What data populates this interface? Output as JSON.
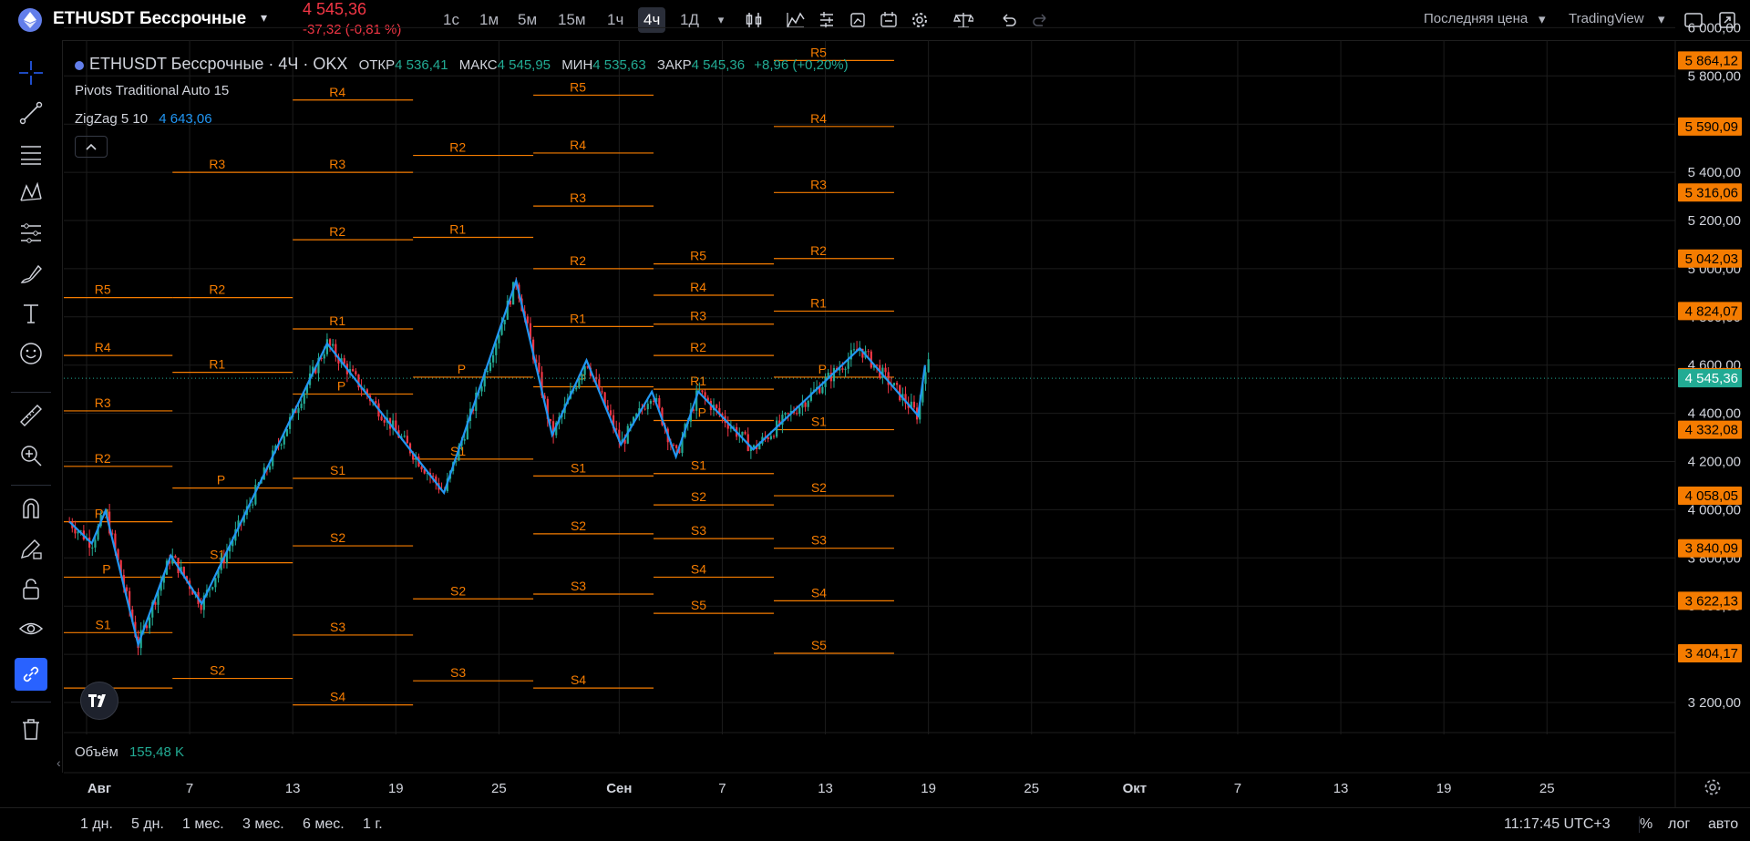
{
  "header": {
    "symbol": "ETHUSDT Бессрочные",
    "price": "4 545,36",
    "change": "-37,32 (-0,81 %)",
    "timeframes": [
      "1с",
      "1м",
      "5м",
      "15м",
      "1ч",
      "4ч",
      "1Д"
    ],
    "active_timeframe": "4ч",
    "price_type": "Последняя цена",
    "broker": "TradingView"
  },
  "legend": {
    "title": "ETHUSDT Бессрочные · 4Ч · OKX",
    "open_label": "ОТКР",
    "open": "4 536,41",
    "high_label": "МАКС",
    "high": "4 545,95",
    "low_label": "МИН",
    "low": "4 535,63",
    "close_label": "ЗАКР",
    "close": "4 545,36",
    "delta": "+8,96 (+0,20%)",
    "pivots": "Pivots Traditional Auto 15",
    "zigzag_label": "ZigZag 5 10",
    "zigzag_value": "4 643,06",
    "volume_label": "Объём",
    "volume_value": "155,48 K",
    "collapse": "^"
  },
  "axis": {
    "price_ticks": [
      {
        "v": 6000,
        "t": "6 000,00"
      },
      {
        "v": 5800,
        "t": "5 800,00"
      },
      {
        "v": 5600,
        "t": "5 600,00"
      },
      {
        "v": 5400,
        "t": "5 400,00"
      },
      {
        "v": 5200,
        "t": "5 200,00"
      },
      {
        "v": 5000,
        "t": "5 000,00"
      },
      {
        "v": 4800,
        "t": "4 800,00"
      },
      {
        "v": 4600,
        "t": "4 600,00"
      },
      {
        "v": 4400,
        "t": "4 400,00"
      },
      {
        "v": 4200,
        "t": "4 200,00"
      },
      {
        "v": 4000,
        "t": "4 000,00"
      },
      {
        "v": 3800,
        "t": "3 800,00"
      },
      {
        "v": 3600,
        "t": "3 600,00"
      },
      {
        "v": 3400,
        "t": "3 400,00"
      },
      {
        "v": 3200,
        "t": "3 200,00"
      }
    ],
    "price_labels": [
      {
        "v": 5864.12,
        "t": "5 864,12"
      },
      {
        "v": 5590.09,
        "t": "5 590,09"
      },
      {
        "v": 5316.06,
        "t": "5 316,06"
      },
      {
        "v": 5042.03,
        "t": "5 042,03"
      },
      {
        "v": 4824.07,
        "t": "4 824,07"
      },
      {
        "v": 4550.04,
        "t": "4 550,04"
      },
      {
        "v": 4332.08,
        "t": "4 332,08"
      },
      {
        "v": 4058.05,
        "t": "4 058,05"
      },
      {
        "v": 3840.09,
        "t": "3 840,09"
      },
      {
        "v": 3622.13,
        "t": "3 622,13"
      },
      {
        "v": 3404.17,
        "t": "3 404,17"
      }
    ],
    "current_label": {
      "v": 4545.36,
      "t": "4 545,36"
    },
    "time_labels": [
      {
        "d": 0,
        "t": "Авг"
      },
      {
        "d": 6,
        "t": "7"
      },
      {
        "d": 12,
        "t": "13"
      },
      {
        "d": 18,
        "t": "19"
      },
      {
        "d": 24,
        "t": "25"
      },
      {
        "d": 31,
        "t": "Сен"
      },
      {
        "d": 37,
        "t": "7"
      },
      {
        "d": 43,
        "t": "13"
      },
      {
        "d": 49,
        "t": "19"
      },
      {
        "d": 55,
        "t": "25"
      },
      {
        "d": 61,
        "t": "Окт"
      },
      {
        "d": 67,
        "t": "7"
      },
      {
        "d": 73,
        "t": "13"
      },
      {
        "d": 79,
        "t": "19"
      },
      {
        "d": 85,
        "t": "25"
      }
    ]
  },
  "chart_data": {
    "type": "candlestick",
    "zigzag": [
      {
        "d": -1.0,
        "p": 3950
      },
      {
        "d": 0.3,
        "p": 3860
      },
      {
        "d": 1.1,
        "p": 3995
      },
      {
        "d": 3.0,
        "p": 3440
      },
      {
        "d": 4.9,
        "p": 3810
      },
      {
        "d": 6.7,
        "p": 3610
      },
      {
        "d": 14.0,
        "p": 4690
      },
      {
        "d": 20.8,
        "p": 4070
      },
      {
        "d": 25.0,
        "p": 4950
      },
      {
        "d": 27.1,
        "p": 4310
      },
      {
        "d": 29.1,
        "p": 4620
      },
      {
        "d": 31.1,
        "p": 4270
      },
      {
        "d": 32.9,
        "p": 4490
      },
      {
        "d": 34.3,
        "p": 4220
      },
      {
        "d": 35.6,
        "p": 4490
      },
      {
        "d": 38.8,
        "p": 4250
      },
      {
        "d": 45.0,
        "p": 4670
      },
      {
        "d": 48.4,
        "p": 4390
      },
      {
        "d": 48.8,
        "p": 4600
      }
    ],
    "pivot_periods": [
      {
        "x0": -1.5,
        "x1": 5.0,
        "levels": [
          {
            "n": "R5",
            "v": 4880
          },
          {
            "n": "R4",
            "v": 4640
          },
          {
            "n": "R3",
            "v": 4410
          },
          {
            "n": "R2",
            "v": 4180
          },
          {
            "n": "R1",
            "v": 3950
          },
          {
            "n": "P",
            "v": 3720
          },
          {
            "n": "S1",
            "v": 3490
          },
          {
            "n": "",
            "v": 3260
          }
        ]
      },
      {
        "x0": 5.0,
        "x1": 12.0,
        "levels": [
          {
            "n": "R3",
            "v": 5400
          },
          {
            "n": "R2",
            "v": 4880
          },
          {
            "n": "R1",
            "v": 4570
          },
          {
            "n": "P",
            "v": 4090
          },
          {
            "n": "S1",
            "v": 3780
          },
          {
            "n": "S2",
            "v": 3300
          }
        ]
      },
      {
        "x0": 12.0,
        "x1": 19.0,
        "levels": [
          {
            "n": "R4",
            "v": 5700
          },
          {
            "n": "R3",
            "v": 5400
          },
          {
            "n": "R2",
            "v": 5120
          },
          {
            "n": "R1",
            "v": 4750
          },
          {
            "n": "P",
            "v": 4480
          },
          {
            "n": "S1",
            "v": 4130
          },
          {
            "n": "S2",
            "v": 3850
          },
          {
            "n": "S3",
            "v": 3480
          },
          {
            "n": "S4",
            "v": 3190
          }
        ]
      },
      {
        "x0": 19.0,
        "x1": 26.0,
        "levels": [
          {
            "n": "R2",
            "v": 5470
          },
          {
            "n": "R1",
            "v": 5130
          },
          {
            "n": "P",
            "v": 4550
          },
          {
            "n": "S1",
            "v": 4210
          },
          {
            "n": "S2",
            "v": 3630
          },
          {
            "n": "S3",
            "v": 3290
          }
        ]
      },
      {
        "x0": 26.0,
        "x1": 33.0,
        "levels": [
          {
            "n": "R5",
            "v": 5720
          },
          {
            "n": "R4",
            "v": 5480
          },
          {
            "n": "R3",
            "v": 5260
          },
          {
            "n": "R2",
            "v": 5000
          },
          {
            "n": "R1",
            "v": 4760
          },
          {
            "n": "P",
            "v": 4510
          },
          {
            "n": "S1",
            "v": 4140
          },
          {
            "n": "S2",
            "v": 3900
          },
          {
            "n": "S3",
            "v": 3650
          },
          {
            "n": "S4",
            "v": 3260
          }
        ]
      },
      {
        "x0": 33.0,
        "x1": 40.0,
        "levels": [
          {
            "n": "R5",
            "v": 5020
          },
          {
            "n": "R4",
            "v": 4890
          },
          {
            "n": "R3",
            "v": 4770
          },
          {
            "n": "R2",
            "v": 4640
          },
          {
            "n": "R1",
            "v": 4500
          },
          {
            "n": "P",
            "v": 4370
          },
          {
            "n": "S1",
            "v": 4150
          },
          {
            "n": "S2",
            "v": 4020
          },
          {
            "n": "S3",
            "v": 3880
          },
          {
            "n": "S4",
            "v": 3720
          },
          {
            "n": "S5",
            "v": 3570
          }
        ]
      },
      {
        "x0": 40.0,
        "x1": 47.0,
        "levels": [
          {
            "n": "R5",
            "v": 5864.12
          },
          {
            "n": "R4",
            "v": 5590.09
          },
          {
            "n": "R3",
            "v": 5316.06
          },
          {
            "n": "R2",
            "v": 5042.03
          },
          {
            "n": "R1",
            "v": 4824.07
          },
          {
            "n": "P",
            "v": 4550.04
          },
          {
            "n": "S1",
            "v": 4332.08
          },
          {
            "n": "S2",
            "v": 4058.05
          },
          {
            "n": "S3",
            "v": 3840.09
          },
          {
            "n": "S4",
            "v": 3622.13
          },
          {
            "n": "S5",
            "v": 3404.17
          }
        ]
      }
    ]
  },
  "ranges": [
    "1 дн.",
    "5 дн.",
    "1 мес.",
    "3 мес.",
    "6 мес.",
    "1 г."
  ],
  "footer": {
    "clock": "11:17:45 UTC+3",
    "percent": "%",
    "log": "лог",
    "auto": "авто"
  },
  "colors": {
    "up": "#22ab94",
    "down": "#f23645",
    "pivot": "#f57c00",
    "zigzag": "#2196f3",
    "accent": "#2962ff",
    "grid": "#1c1c1c"
  }
}
